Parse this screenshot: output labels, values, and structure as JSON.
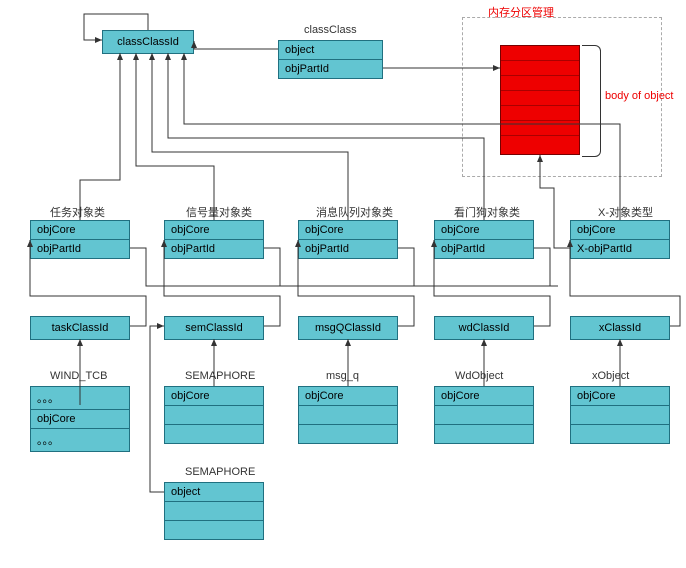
{
  "top": {
    "classClassId": "classClassId",
    "classClass": {
      "title": "classClass",
      "r1": "object",
      "r2": "objPartId"
    },
    "memTitle": "内存分区管理",
    "bodyOf": "body of object"
  },
  "labels": {
    "task": "任务对象类",
    "sem": "信号量对象类",
    "msgq": "消息队列对象类",
    "wd": "看门狗对象类",
    "xtype": "X-对象类型"
  },
  "classBoxes": {
    "task": {
      "r1": "objCore",
      "r2": "objPartId"
    },
    "sem": {
      "r1": "objCore",
      "r2": "objPartId"
    },
    "msgq": {
      "r1": "objCore",
      "r2": "objPartId"
    },
    "wd": {
      "r1": "objCore",
      "r2": "objPartId"
    },
    "x": {
      "r1": "objCore",
      "r2": "X-objPartId"
    }
  },
  "classIds": {
    "task": "taskClassId",
    "sem": "semClassId",
    "msgq": "msgQClassId",
    "wd": "wdClassId",
    "x": "xClassId"
  },
  "instances": {
    "wind": {
      "title": "WIND_TCB",
      "r1": "。。。",
      "r2": "objCore",
      "r3": "。。。"
    },
    "semaphore": {
      "title": "SEMAPHORE",
      "r1": "objCore"
    },
    "msg_q": {
      "title": "msg_q",
      "r1": "objCore"
    },
    "wdObject": {
      "title": "WdObject",
      "r1": "objCore"
    },
    "xObject": {
      "title": "xObject",
      "r1": "objCore"
    },
    "semaphore2": {
      "title": "SEMAPHORE",
      "r1": "object"
    }
  }
}
